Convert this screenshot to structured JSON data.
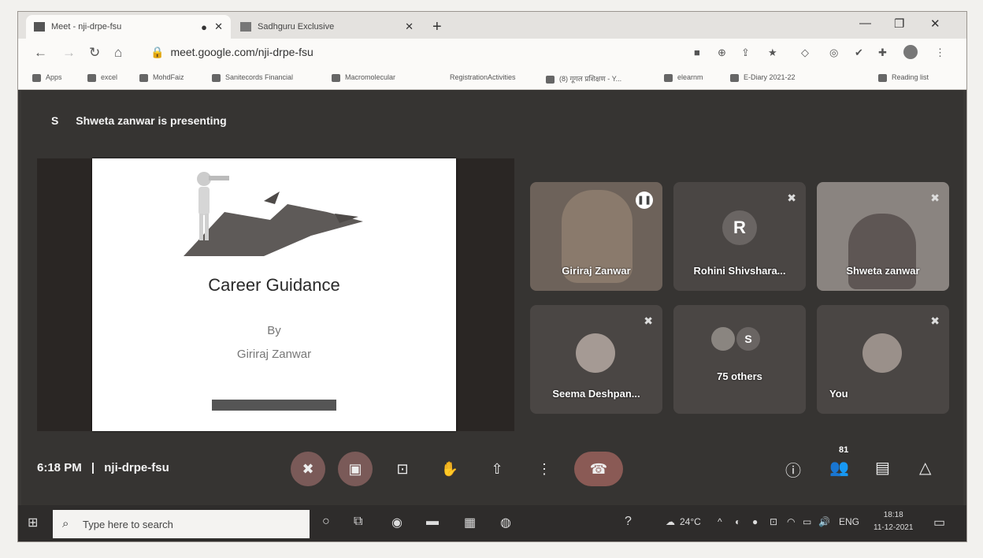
{
  "browser": {
    "tabs": [
      {
        "label": "Meet - nji-drpe-fsu"
      },
      {
        "label": "Sadhguru Exclusive"
      }
    ],
    "new_tab": "+",
    "url": "meet.google.com/nji-drpe-fsu",
    "bookmarks": [
      {
        "label": "Apps"
      },
      {
        "label": "excel"
      },
      {
        "label": "MohdFaiz"
      },
      {
        "label": "Sanitecords Financial"
      },
      {
        "label": "Macromolecular"
      },
      {
        "label": "RegistrationActivities"
      },
      {
        "label": "(8) गूगल प्रशिक्षण - Y..."
      },
      {
        "label": "elearnm"
      },
      {
        "label": "E-Diary 2021-22"
      },
      {
        "label": "Reading list"
      }
    ]
  },
  "meet": {
    "presenter_initial": "S",
    "presenting_text": "Shweta zanwar is presenting",
    "slide": {
      "title": "Career Guidance",
      "by": "By",
      "author": "Giriraj Zanwar"
    },
    "participants": [
      {
        "name": "Giriraj Zanwar"
      },
      {
        "name": "Rohini Shivshara...",
        "initial": "R"
      },
      {
        "name": "Shweta zanwar"
      },
      {
        "name": "Seema Deshpan..."
      },
      {
        "name": "75 others",
        "initial": "S"
      },
      {
        "name": "You"
      }
    ],
    "time": "6:18 PM",
    "separator": "|",
    "meeting_code": "nji-drpe-fsu",
    "people_count": "81"
  },
  "taskbar": {
    "search_placeholder": "Type here to search",
    "temperature": "24°C",
    "language": "ENG",
    "time": "18:18",
    "date": "11-12-2021"
  }
}
